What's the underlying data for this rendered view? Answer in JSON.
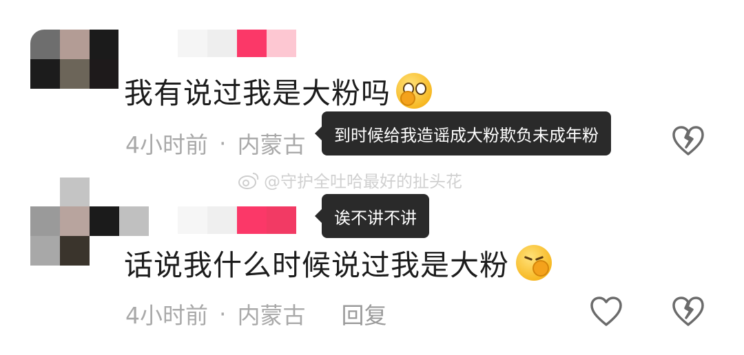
{
  "comments": [
    {
      "text": "我有说过我是大粉吗",
      "emoji": "shushing-face-emoji",
      "time": "4小时前",
      "separator": "·",
      "location": "内蒙古"
    },
    {
      "text": "话说我什么时候说过我是大粉",
      "emoji": "thinking-hand-face-emoji",
      "time": "4小时前",
      "separator": "·",
      "location": "内蒙古",
      "reply": "回复"
    }
  ],
  "tooltips": [
    {
      "text": "到时候给我造谣成大粉欺负未成年粉"
    },
    {
      "text": "诶不讲不讲"
    }
  ],
  "watermark": "@守护全吐哈最好的扯头花",
  "icons": {
    "like": "heart-outline-icon",
    "dislike": "broken-heart-icon",
    "weibo": "weibo-logo-icon"
  },
  "colors": {
    "accent_pink": "#ff3a6e",
    "meta_gray": "#a9a9a9",
    "tooltip_bg": "#2a2a2a"
  }
}
